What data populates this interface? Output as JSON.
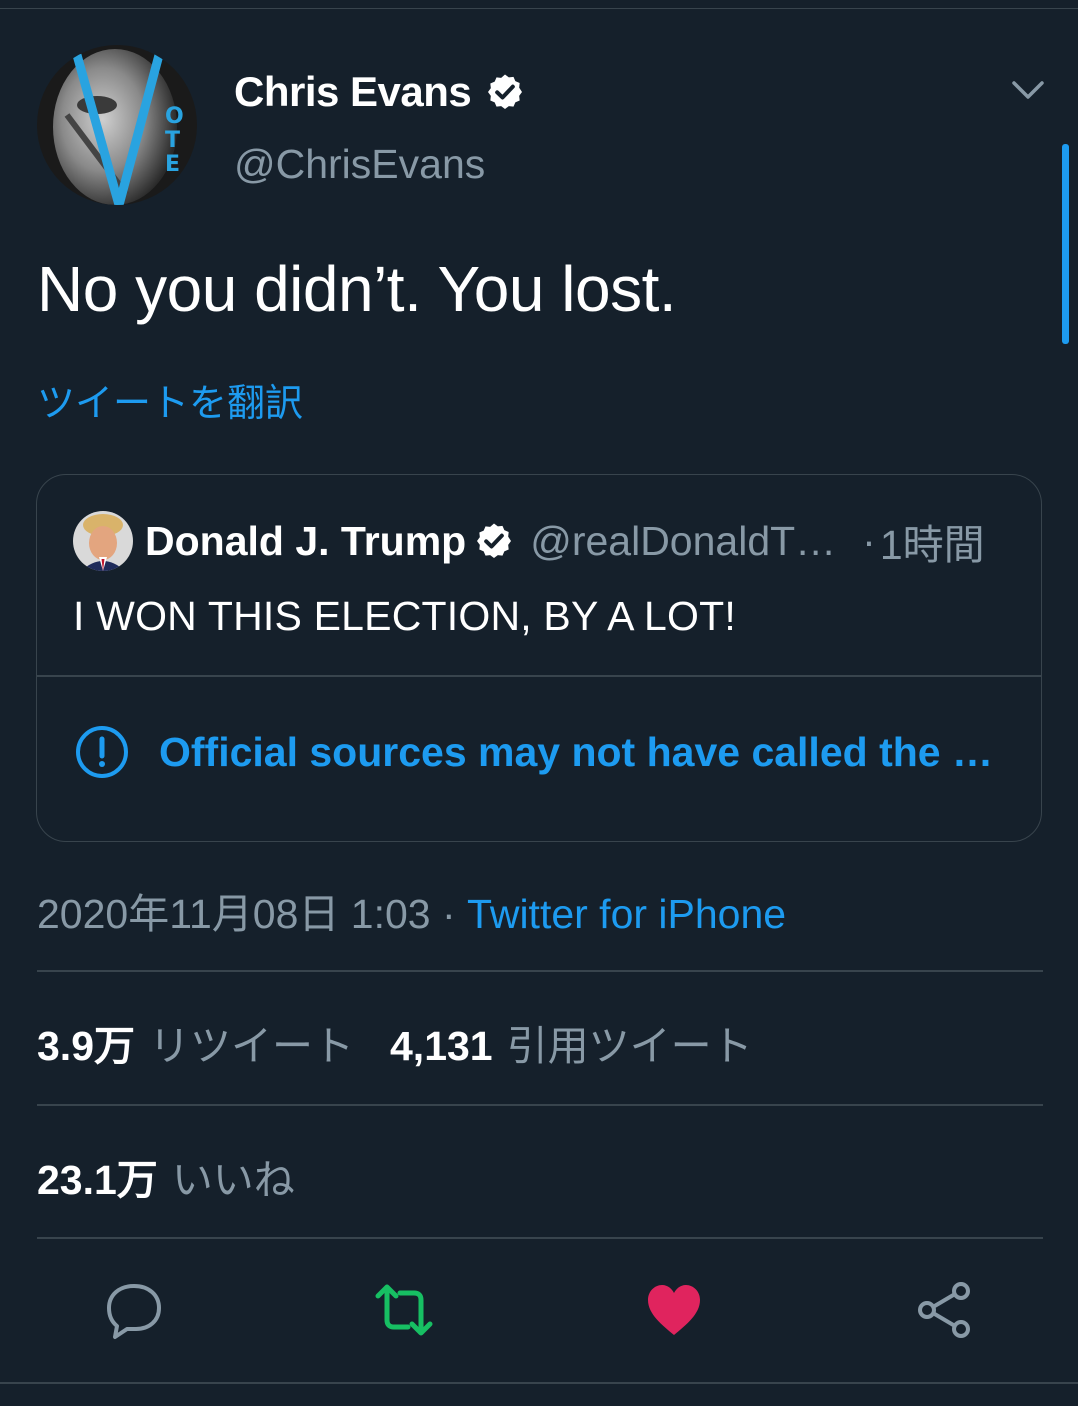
{
  "tweet": {
    "author": {
      "display_name": "Chris Evans",
      "handle": "@ChrisEvans",
      "verified": true
    },
    "text": "No you didn’t. You lost.",
    "translate_label": "ツイートを翻訳",
    "quote": {
      "author_name": "Donald J. Trump",
      "author_handle": "@realDonaldT…",
      "dot": "·",
      "time": "1時間",
      "text": "I WON THIS ELECTION, BY A LOT!",
      "notice": "Official sources may not have called the …"
    },
    "timestamp": "2020年11月08日 1:03",
    "meta_separator": "·",
    "source": "Twitter for iPhone",
    "stats": {
      "retweets_count": "3.9万",
      "retweets_label": "リツイート",
      "quotes_count": "4,131",
      "quotes_label": "引用ツイート",
      "likes_count": "23.1万",
      "likes_label": "いいね"
    },
    "liked": true,
    "retweeted": true
  },
  "icons": {
    "verified": "verified-badge-icon",
    "menu": "chevron-down-icon",
    "notice": "exclamation-circle-icon",
    "reply": "reply-icon",
    "retweet": "retweet-icon",
    "like": "heart-icon",
    "share": "share-icon"
  },
  "colors": {
    "background": "#15202b",
    "accent": "#1d9bf0",
    "muted": "#8899a6",
    "border": "#38444d",
    "retweet_active": "#17bf63",
    "like_active": "#e0245e"
  }
}
